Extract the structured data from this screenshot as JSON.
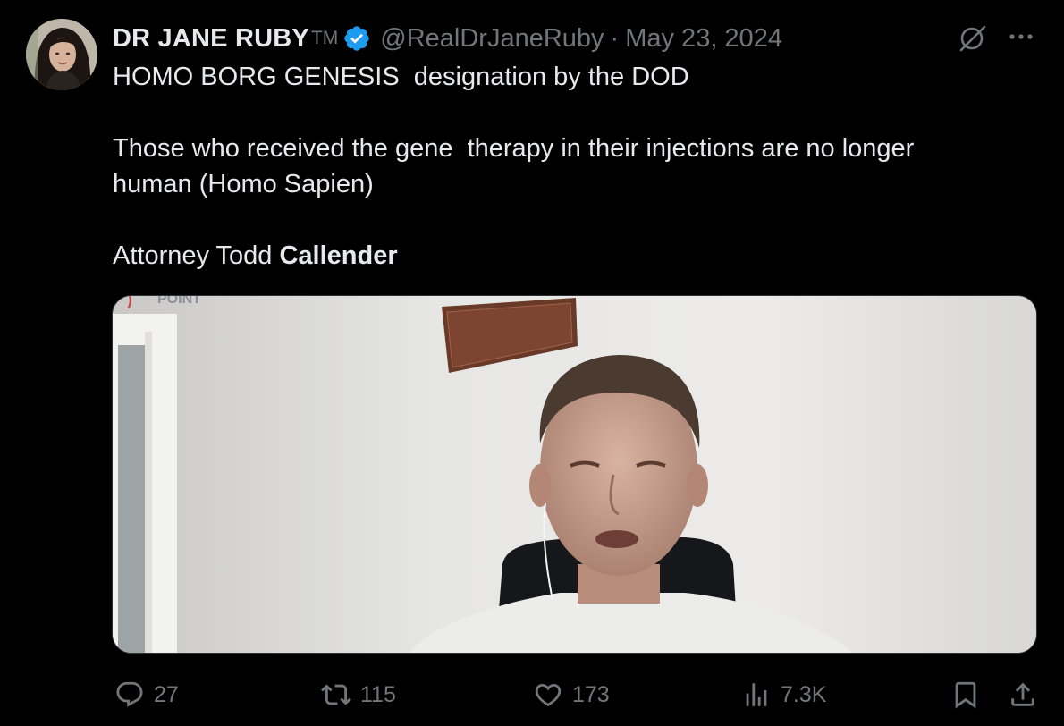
{
  "author": {
    "name": "DR JANE RUBY",
    "name_suffix": "TM",
    "handle": "@RealDrJaneRuby",
    "separator": "·",
    "date": "May 23, 2024",
    "verified": true
  },
  "tweet": {
    "line1": "HOMO BORG GENESIS  designation by the DOD",
    "line2": "Those who received the gene  therapy in their injections are no longer",
    "line3": "human (Homo Sapien)",
    "line4_regular": "Attorney Todd ",
    "line4_bold": "Callender"
  },
  "media": {
    "video_watermark": "POINT"
  },
  "actions": {
    "replies": "27",
    "reposts": "115",
    "likes": "173",
    "views": "7.3K"
  },
  "colors": {
    "background": "#000000",
    "text_primary": "#e7e9ea",
    "text_secondary": "#71767b",
    "verified_badge": "#1d9bf0"
  },
  "icons": {
    "verified": "verified-badge-icon",
    "grok": "grok-icon",
    "more": "more-icon",
    "reply": "reply-icon",
    "repost": "repost-icon",
    "like": "heart-icon",
    "views": "views-icon",
    "bookmark": "bookmark-icon",
    "share": "share-icon"
  }
}
